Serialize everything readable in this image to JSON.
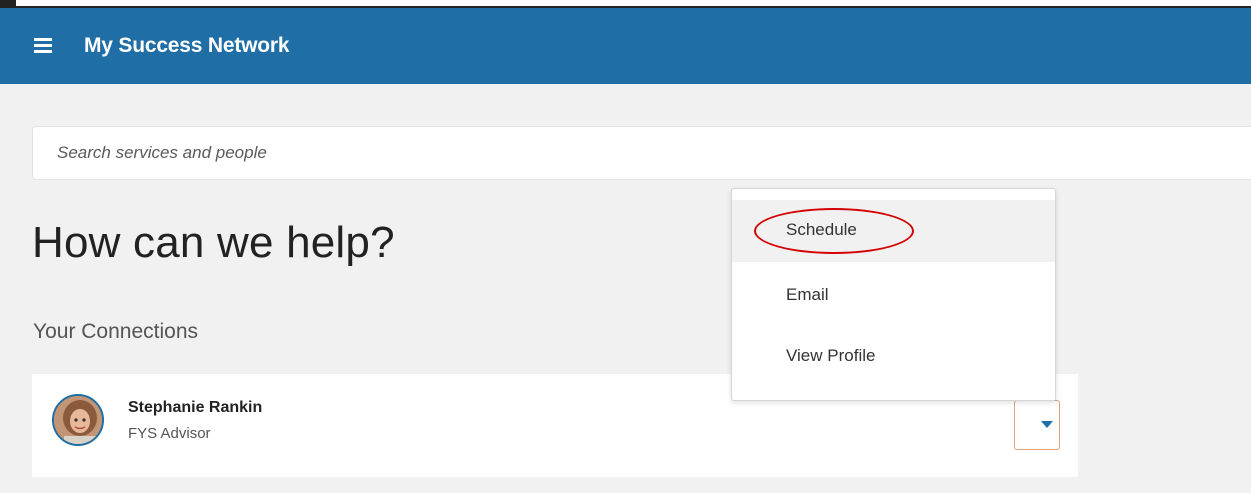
{
  "header": {
    "title": "My Success Network",
    "menu_icon": "hamburger-icon"
  },
  "search": {
    "placeholder": "Search services and people",
    "value": ""
  },
  "main": {
    "heading": "How can we help?",
    "connections_heading": "Your Connections"
  },
  "connections": [
    {
      "name": "Stephanie Rankin",
      "role": "FYS Advisor",
      "avatar": "person-avatar"
    }
  ],
  "dropdown": {
    "items": [
      {
        "label": "Schedule",
        "highlighted": true
      },
      {
        "label": "Email"
      },
      {
        "label": "View Profile"
      }
    ]
  },
  "colors": {
    "brand": "#1f6ea5",
    "background": "#f1f1f1",
    "annotation": "#d40000",
    "toggle_border": "#e3a07a"
  }
}
